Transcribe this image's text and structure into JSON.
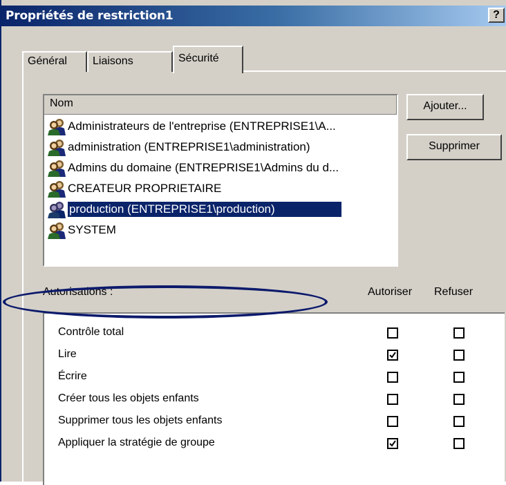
{
  "window": {
    "title": "Propriétés de restriction1",
    "help_label": "?"
  },
  "tabs": [
    {
      "label": "Général",
      "active": false
    },
    {
      "label": "Liaisons",
      "active": false
    },
    {
      "label": "Sécurité",
      "active": true
    }
  ],
  "principals": {
    "column_header": "Nom",
    "items": [
      {
        "label": "Administrateurs de l'entreprise (ENTREPRISE1\\A...",
        "icon": "users-group-icon",
        "selected": false
      },
      {
        "label": "administration (ENTREPRISE1\\administration)",
        "icon": "users-group-icon",
        "selected": false
      },
      {
        "label": "Admins du domaine (ENTREPRISE1\\Admins du d...",
        "icon": "users-group-icon",
        "selected": false
      },
      {
        "label": "CREATEUR PROPRIETAIRE",
        "icon": "users-group-icon",
        "selected": false
      },
      {
        "label": "production (ENTREPRISE1\\production)",
        "icon": "users-group-icon",
        "selected": true
      },
      {
        "label": "SYSTEM",
        "icon": "users-group-icon",
        "selected": false
      }
    ]
  },
  "buttons": {
    "add_label": "Ajouter...",
    "remove_label": "Supprimer"
  },
  "permissions": {
    "label": "Autorisations :",
    "allow_header": "Autoriser",
    "deny_header": "Refuser",
    "rows": [
      {
        "name": "Contrôle total",
        "allow": false,
        "deny": false
      },
      {
        "name": "Lire",
        "allow": true,
        "deny": false
      },
      {
        "name": "Écrire",
        "allow": false,
        "deny": false
      },
      {
        "name": "Créer tous les objets enfants",
        "allow": false,
        "deny": false
      },
      {
        "name": "Supprimer tous les objets enfants",
        "allow": false,
        "deny": false
      },
      {
        "name": "Appliquer la stratégie de groupe",
        "allow": true,
        "deny": false
      }
    ]
  },
  "colors": {
    "title_bar": "#0a246a",
    "selection": "#0a246a",
    "annotation_ellipse": "#0c1a6b",
    "face": "#d4d0c8"
  }
}
